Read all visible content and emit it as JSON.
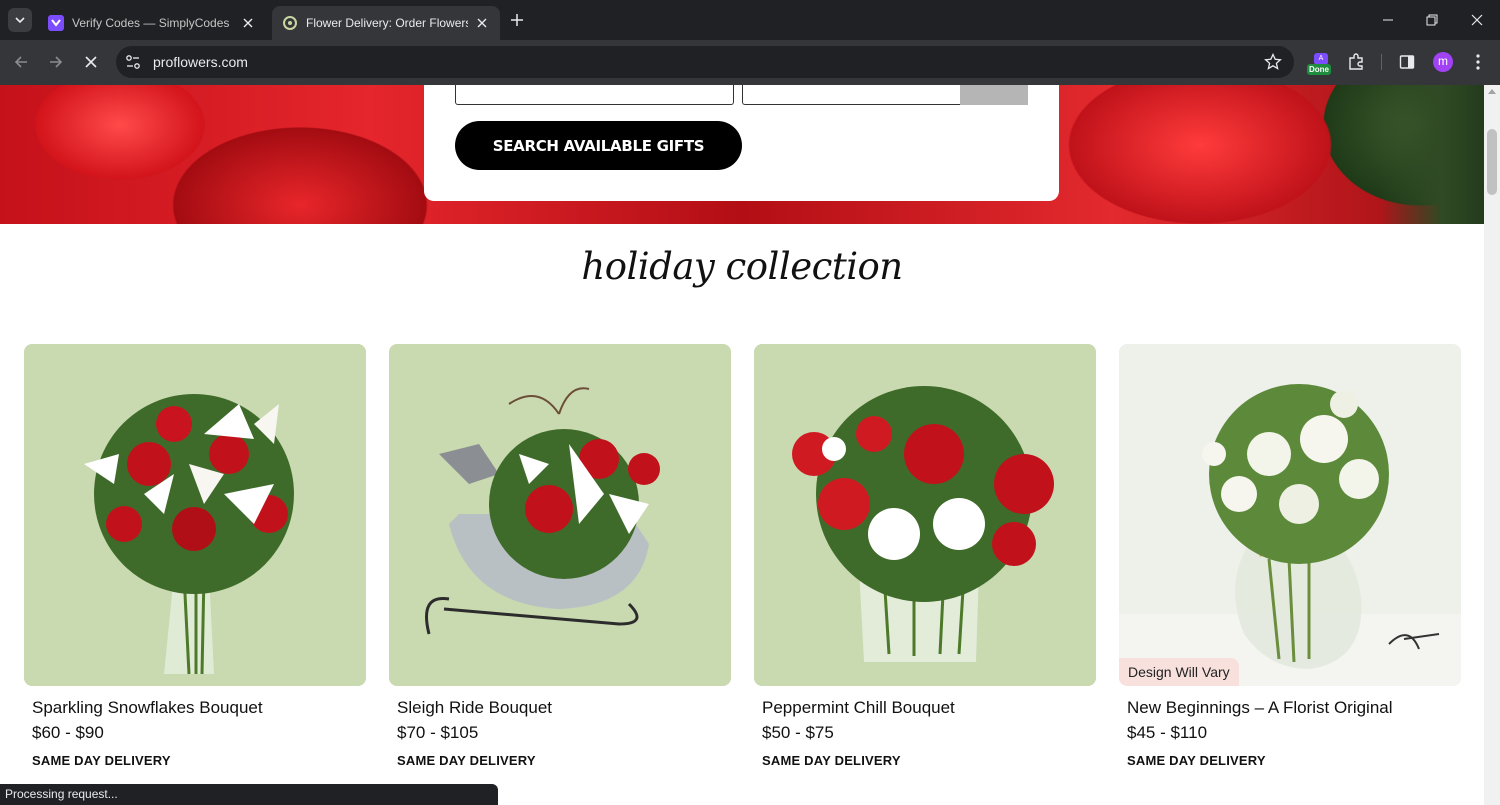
{
  "browser": {
    "tabs": [
      {
        "title": "Verify Codes — SimplyCodes",
        "active": false
      },
      {
        "title": "Flower Delivery: Order Flowers Online",
        "active": true
      }
    ],
    "url": "proflowers.com",
    "extension_badge": "Done",
    "extension_badge_top": "A",
    "profile_initial": "m"
  },
  "hero": {
    "search_button_label": "SEARCH AVAILABLE GIFTS"
  },
  "section": {
    "title": "holiday collection"
  },
  "products": [
    {
      "name": "Sparkling Snowflakes Bouquet",
      "price": "$60 - $90",
      "delivery": "SAME DAY DELIVERY"
    },
    {
      "name": "Sleigh Ride Bouquet",
      "price": "$70 - $105",
      "delivery": "SAME DAY DELIVERY"
    },
    {
      "name": "Peppermint Chill Bouquet",
      "price": "$50 - $75",
      "delivery": "SAME DAY DELIVERY"
    },
    {
      "name": "New Beginnings – A Florist Original",
      "price": "$45 - $110",
      "delivery": "SAME DAY DELIVERY",
      "badge": "Design Will Vary"
    }
  ],
  "status": {
    "text": "Processing request..."
  },
  "colors": {
    "chrome_dark": "#202124",
    "chrome_toolbar": "#35363a",
    "product_bg": "#c9d9b0",
    "badge_bg": "#f8e1dc",
    "button_black": "#000000"
  }
}
